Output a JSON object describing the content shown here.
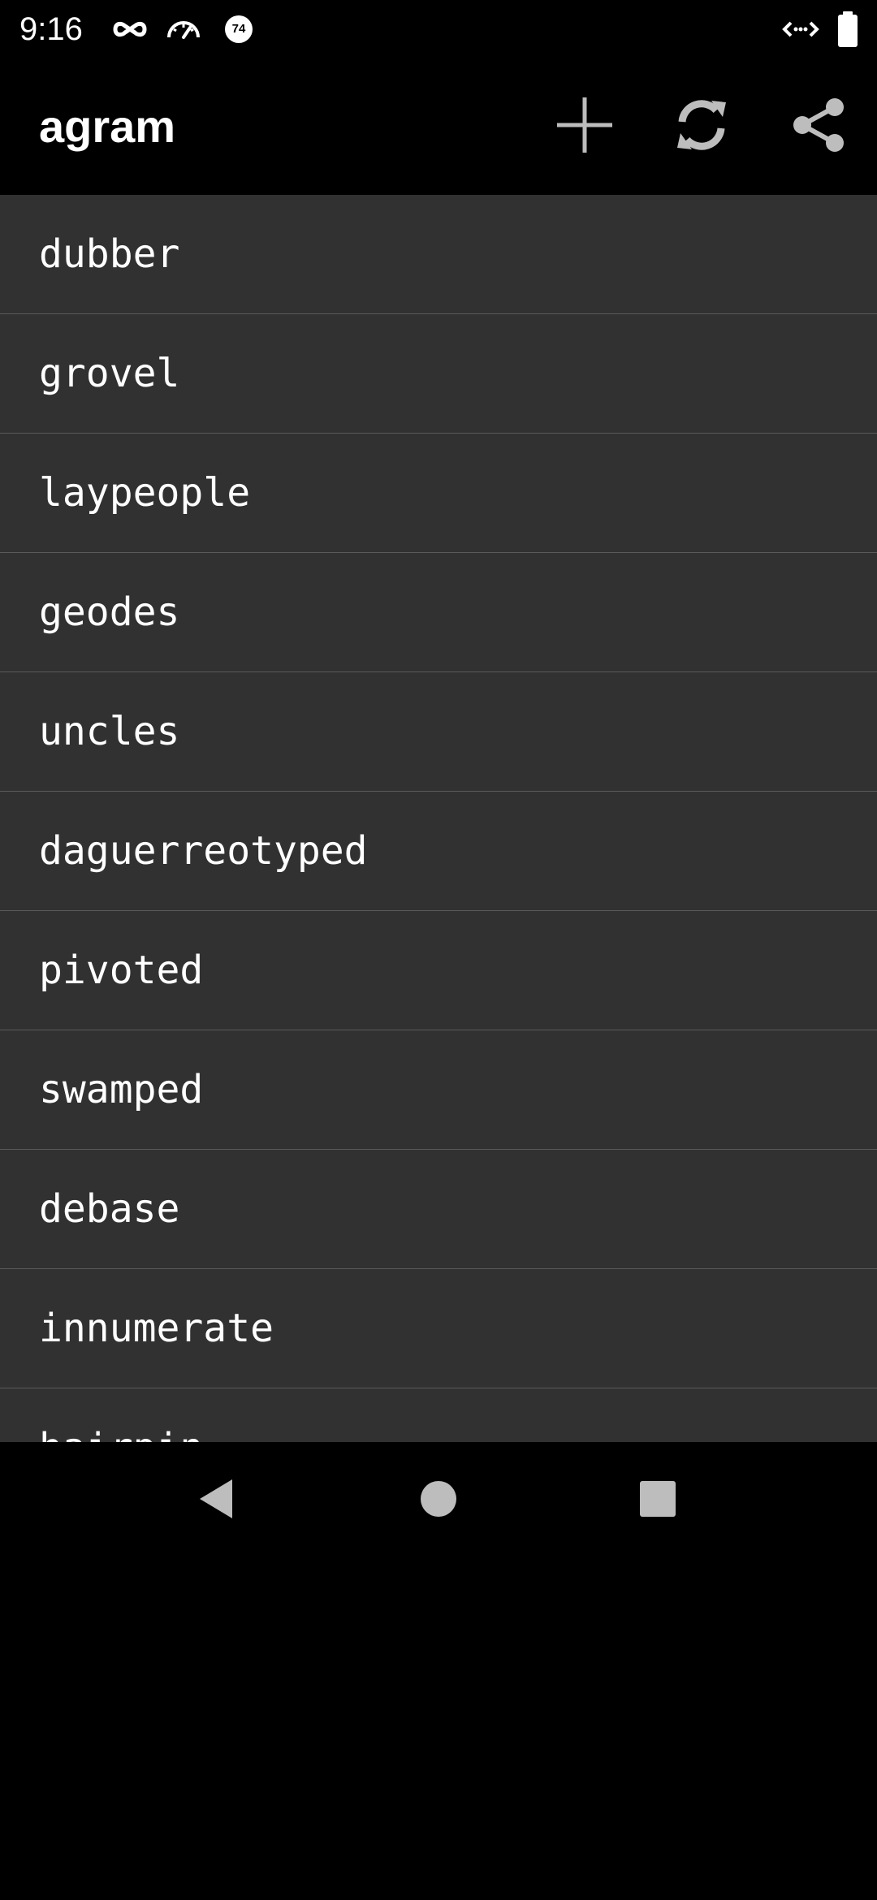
{
  "status_bar": {
    "time": "9:16",
    "icons_left": [
      "incognito-icon",
      "speedometer-icon",
      "badge-74-icon"
    ],
    "badge_number": "74",
    "icons_right": [
      "data-transfer-icon",
      "battery-icon"
    ]
  },
  "app_bar": {
    "title": "agram",
    "actions": [
      {
        "name": "add",
        "icon": "plus-icon"
      },
      {
        "name": "refresh",
        "icon": "refresh-icon"
      },
      {
        "name": "share",
        "icon": "share-icon"
      }
    ]
  },
  "words": [
    {
      "text": "dubber"
    },
    {
      "text": "grovel"
    },
    {
      "text": "laypeople"
    },
    {
      "text": "geodes"
    },
    {
      "text": "uncles"
    },
    {
      "text": "daguerreotyped"
    },
    {
      "text": "pivoted"
    },
    {
      "text": "swamped"
    },
    {
      "text": "debase"
    },
    {
      "text": "innumerate"
    },
    {
      "text": "hairpin"
    }
  ],
  "nav_bar": {
    "buttons": [
      "back-icon",
      "home-icon",
      "recents-icon"
    ]
  },
  "colors": {
    "background": "#000000",
    "list_background": "#313131",
    "divider": "#5a5a5a",
    "text": "#ffffff",
    "icon_grey": "#bdbdbd"
  }
}
